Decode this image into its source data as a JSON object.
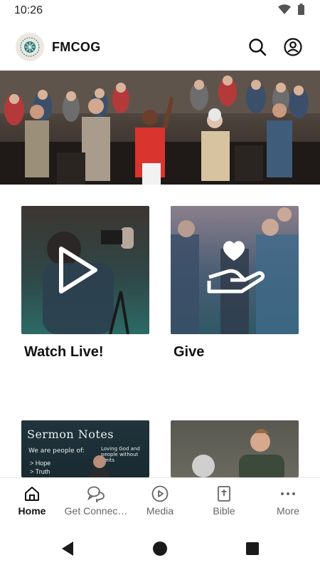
{
  "status": {
    "time": "10:26"
  },
  "header": {
    "title": "FMCOG"
  },
  "tiles": [
    {
      "caption": "Watch Live!"
    },
    {
      "caption": "Give"
    }
  ],
  "sermon_card": {
    "title": "Sermon Notes",
    "subtitle": "We are people of:",
    "side_text": "Loving God and people without limits",
    "list": [
      "> Hope",
      "> Truth"
    ]
  },
  "bottom_nav": {
    "items": [
      {
        "label": "Home",
        "active": true
      },
      {
        "label": "Get Connec…"
      },
      {
        "label": "Media"
      },
      {
        "label": "Bible"
      },
      {
        "label": "More"
      }
    ]
  },
  "colors": {
    "accent": "#111111",
    "inactive": "#666666"
  }
}
